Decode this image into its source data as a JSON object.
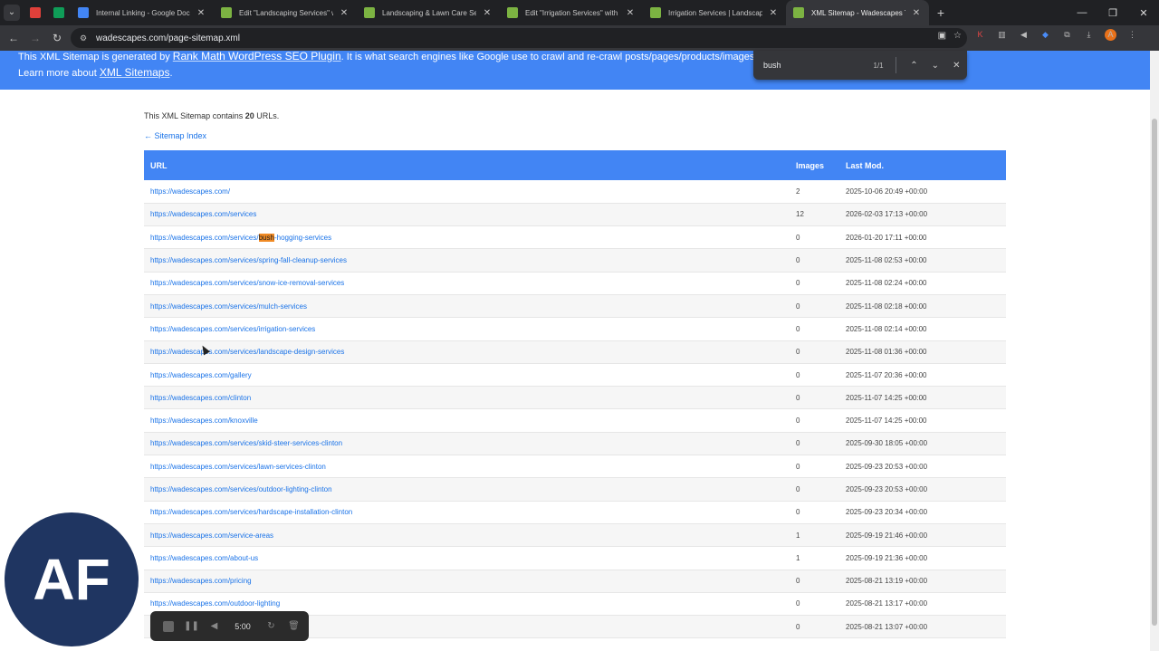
{
  "tabs": [
    {
      "title": "",
      "favicon_color": "#e0403a",
      "active": false,
      "icon": "record-icon"
    },
    {
      "title": "",
      "favicon_color": "#0f9d58",
      "active": false,
      "icon": "sheets-icon"
    },
    {
      "title": "Internal Linking - Google Docs",
      "favicon_color": "#4285f4",
      "active": false,
      "icon": "docs-icon"
    },
    {
      "title": "Edit \"Landscaping Services\" wit",
      "favicon_color": "#7cb342",
      "active": false,
      "icon": "site-icon"
    },
    {
      "title": "Landscaping & Lawn Care Serv",
      "favicon_color": "#7cb342",
      "active": false,
      "icon": "site-icon"
    },
    {
      "title": "Edit \"Irrigation Services\" with El",
      "favicon_color": "#7cb342",
      "active": false,
      "icon": "site-icon"
    },
    {
      "title": "Irrigation Services | Landscapin",
      "favicon_color": "#7cb342",
      "active": false,
      "icon": "site-icon"
    },
    {
      "title": "XML Sitemap - Wadescapes To",
      "favicon_color": "#7cb342",
      "active": true,
      "icon": "site-icon"
    }
  ],
  "address": {
    "url": "wadescapes.com/page-sitemap.xml"
  },
  "find": {
    "query": "bush",
    "count": "1/1"
  },
  "banner": {
    "prefix": "This XML Sitemap is generated by ",
    "plugin_link": "Rank Math WordPress SEO Plugin",
    "suffix": ". It is what search engines like Google use to crawl and re-crawl posts/pages/products/images/archives on yo",
    "learn_prefix": "Learn more about ",
    "learn_link": "XML Sitemaps",
    "learn_suffix": "."
  },
  "intro": {
    "prefix": "This XML Sitemap contains ",
    "count": "20",
    "suffix": " URLs."
  },
  "index_link": "← Sitemap Index",
  "table": {
    "headers": {
      "url": "URL",
      "images": "Images",
      "lastmod": "Last Mod."
    },
    "rows": [
      {
        "url": "https://wadescapes.com/",
        "images": "2",
        "lastmod": "2025-10-06 20:49 +00:00"
      },
      {
        "url": "https://wadescapes.com/services",
        "images": "12",
        "lastmod": "2026-02-03 17:13 +00:00"
      },
      {
        "url": "https://wadescapes.com/services/bush-hogging-services",
        "url_pre": "https://wadescapes.com/services/",
        "url_hl": "bush",
        "url_post": "-hogging-services",
        "images": "0",
        "lastmod": "2026-01-20 17:11 +00:00"
      },
      {
        "url": "https://wadescapes.com/services/spring-fall-cleanup-services",
        "images": "0",
        "lastmod": "2025-11-08 02:53 +00:00"
      },
      {
        "url": "https://wadescapes.com/services/snow-ice-removal-services",
        "images": "0",
        "lastmod": "2025-11-08 02:24 +00:00"
      },
      {
        "url": "https://wadescapes.com/services/mulch-services",
        "images": "0",
        "lastmod": "2025-11-08 02:18 +00:00"
      },
      {
        "url": "https://wadescapes.com/services/irrigation-services",
        "images": "0",
        "lastmod": "2025-11-08 02:14 +00:00"
      },
      {
        "url": "https://wadescapes.com/services/landscape-design-services",
        "images": "0",
        "lastmod": "2025-11-08 01:36 +00:00"
      },
      {
        "url": "https://wadescapes.com/gallery",
        "images": "0",
        "lastmod": "2025-11-07 20:36 +00:00"
      },
      {
        "url": "https://wadescapes.com/clinton",
        "images": "0",
        "lastmod": "2025-11-07 14:25 +00:00"
      },
      {
        "url": "https://wadescapes.com/knoxville",
        "images": "0",
        "lastmod": "2025-11-07 14:25 +00:00"
      },
      {
        "url": "https://wadescapes.com/services/skid-steer-services-clinton",
        "images": "0",
        "lastmod": "2025-09-30 18:05 +00:00"
      },
      {
        "url": "https://wadescapes.com/services/lawn-services-clinton",
        "images": "0",
        "lastmod": "2025-09-23 20:53 +00:00"
      },
      {
        "url": "https://wadescapes.com/services/outdoor-lighting-clinton",
        "images": "0",
        "lastmod": "2025-09-23 20:53 +00:00"
      },
      {
        "url": "https://wadescapes.com/services/hardscape-installation-clinton",
        "images": "0",
        "lastmod": "2025-09-23 20:34 +00:00"
      },
      {
        "url": "https://wadescapes.com/service-areas",
        "images": "1",
        "lastmod": "2025-09-19 21:46 +00:00"
      },
      {
        "url": "https://wadescapes.com/about-us",
        "images": "1",
        "lastmod": "2025-09-19 21:36 +00:00"
      },
      {
        "url": "https://wadescapes.com/pricing",
        "images": "0",
        "lastmod": "2025-08-21 13:19 +00:00"
      },
      {
        "url": "https://wadescapes.com/outdoor-lighting",
        "images": "0",
        "lastmod": "2025-08-21 13:17 +00:00"
      },
      {
        "url": "",
        "images": "0",
        "lastmod": "2025-08-21 13:07 +00:00"
      }
    ]
  },
  "overlay": {
    "badge": "AF",
    "timer": "5:00"
  },
  "colors": {
    "banner": "#4285f4",
    "link": "#1a73e8",
    "highlight": "#f08a24"
  }
}
